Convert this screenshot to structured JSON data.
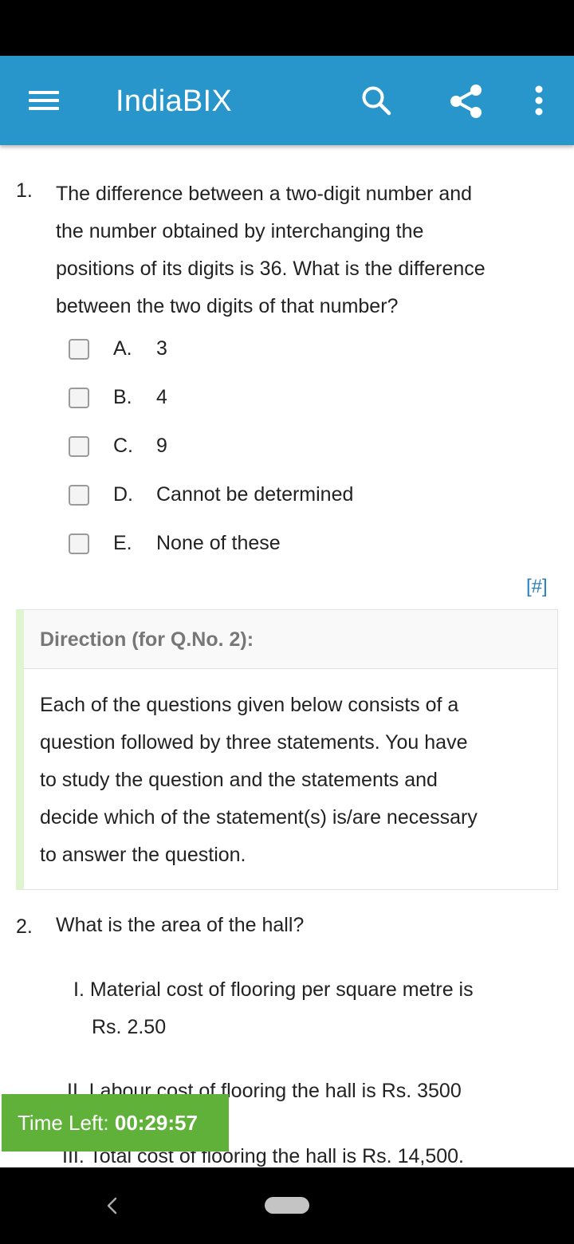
{
  "app_bar": {
    "title": "IndiaBIX"
  },
  "icons": {
    "menu": "menu-icon",
    "search": "search-icon",
    "share": "share-icon",
    "more": "more-vertical-icon",
    "back": "back-icon"
  },
  "colors": {
    "app_bar": "#2896cb",
    "timer": "#5fb13a",
    "link": "#2a7fbd",
    "direction_accent": "#dff5d0"
  },
  "question1": {
    "number": "1.",
    "lines": [
      "The difference between a two-digit number and",
      "the number obtained by interchanging the",
      "positions of its digits is 36. What is the difference",
      "between the two digits of that number?"
    ],
    "options": [
      {
        "letter": "A.",
        "text": "3",
        "checked": false
      },
      {
        "letter": "B.",
        "text": "4",
        "checked": false
      },
      {
        "letter": "C.",
        "text": "9",
        "checked": false
      },
      {
        "letter": "D.",
        "text": "Cannot be determined",
        "checked": false
      },
      {
        "letter": "E.",
        "text": "None of these",
        "checked": false
      }
    ],
    "link": "[#]"
  },
  "direction": {
    "title": "Direction (for Q.No. 2):",
    "lines": [
      "Each of the questions given below consists of a",
      "question followed by three statements. You have",
      "to study the question and the statements and",
      "decide which of the statement(s) is/are necessary",
      "to answer the question."
    ]
  },
  "question2": {
    "number": "2.",
    "text": "What is the area of the hall?",
    "statements": [
      {
        "lines": [
          "I. Material cost of flooring per square metre is",
          "Rs. 2.50"
        ]
      },
      {
        "lines": [
          "II. Labour cost of flooring the hall is Rs. 3500"
        ]
      },
      {
        "lines": [
          "III. Total cost of flooring the hall is Rs. 14,500."
        ]
      }
    ]
  },
  "timer": {
    "label": "Time Left: ",
    "value": "00:29:57"
  }
}
